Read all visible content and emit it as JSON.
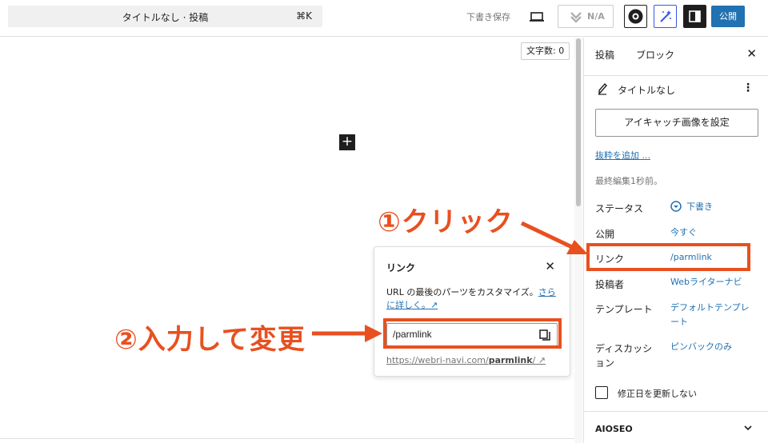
{
  "topbar": {
    "doc_title": "タイトルなし · 投稿",
    "shortcut": "⌘K",
    "save_draft": "下書き保存",
    "na_label": "N/A",
    "publish_label": "公開"
  },
  "editor": {
    "word_count": "文字数: 0",
    "add_block": "+"
  },
  "popover": {
    "title": "リンク",
    "desc_plain": "URL の最後のパーツをカスタマイズ。",
    "desc_link": "さらに詳しく。↗",
    "slug_value": "/parmlink",
    "full_url_prefix": "https://webri-navi.com/",
    "full_url_slug": "parmlink",
    "full_url_suffix": "/ ↗"
  },
  "sidebar": {
    "tabs": [
      "投稿",
      "ブロック"
    ],
    "post_title": "タイトルなし",
    "featured_image_button": "アイキャッチ画像を設定",
    "add_excerpt": "抜粋を追加 ...",
    "last_edited": "最終編集1秒前。",
    "rows": [
      {
        "label": "ステータス",
        "value": "下書き"
      },
      {
        "label": "公開",
        "value": "今すぐ"
      },
      {
        "label": "リンク",
        "value": "/parmlink"
      },
      {
        "label": "投稿者",
        "value": "Webライターナビ"
      },
      {
        "label": "テンプレート",
        "value": "デフォルトテンプレート"
      },
      {
        "label": "ディスカッション",
        "value": "ピンバックのみ"
      }
    ],
    "checkbox_label": "修正日を更新しない",
    "aioseo": "AIOSEO"
  },
  "annotations": {
    "step1": "①クリック",
    "step2": "②入力して変更",
    "color": "#e8501f"
  }
}
